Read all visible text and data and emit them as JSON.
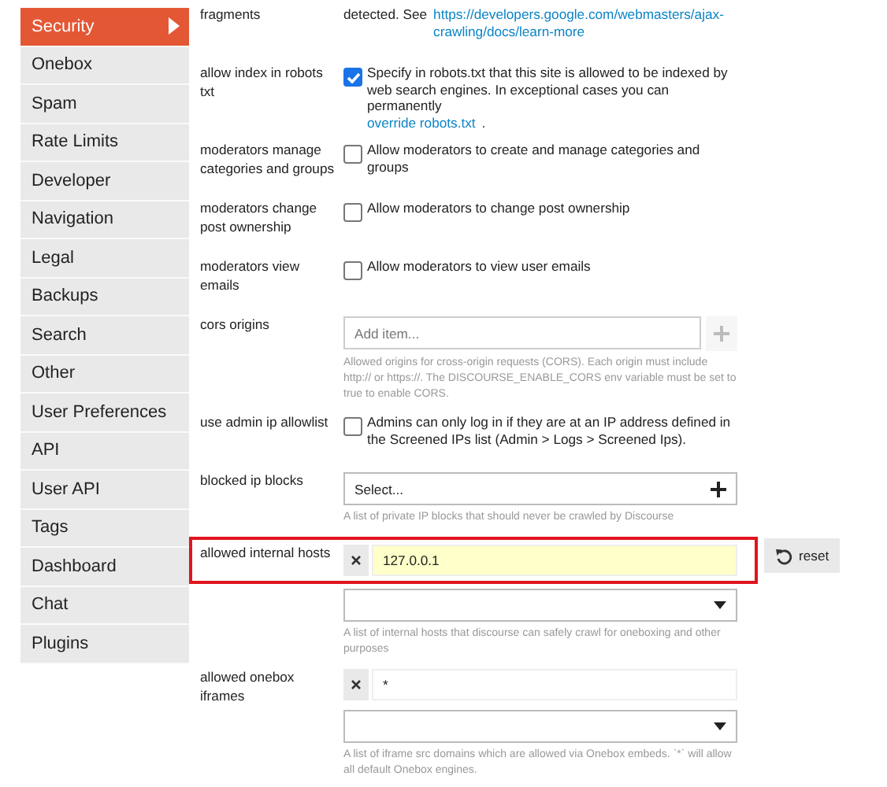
{
  "sidebar": {
    "items": [
      {
        "label": "Security",
        "selected": true
      },
      {
        "label": "Onebox",
        "selected": false
      },
      {
        "label": "Spam",
        "selected": false
      },
      {
        "label": "Rate Limits",
        "selected": false
      },
      {
        "label": "Developer",
        "selected": false
      },
      {
        "label": "Navigation",
        "selected": false
      },
      {
        "label": "Legal",
        "selected": false
      },
      {
        "label": "Backups",
        "selected": false
      },
      {
        "label": "Search",
        "selected": false
      },
      {
        "label": "Other",
        "selected": false
      },
      {
        "label": "User Preferences",
        "selected": false
      },
      {
        "label": "API",
        "selected": false
      },
      {
        "label": "User API",
        "selected": false
      },
      {
        "label": "Tags",
        "selected": false
      },
      {
        "label": "Dashboard",
        "selected": false
      },
      {
        "label": "Chat",
        "selected": false
      },
      {
        "label": "Plugins",
        "selected": false
      }
    ]
  },
  "settings": [
    {
      "kind": "text",
      "label": "fragments",
      "description": [
        {
          "text": "detected. See"
        },
        {
          "link": "https://developers.google.com/webmasters/ajax-crawling/docs/learn-more"
        }
      ]
    },
    {
      "kind": "checkbox",
      "label": "allow index in robots txt",
      "checked": true,
      "description": [
        {
          "text": "Specify in robots.txt that this site is allowed to be indexed by web search engines. In exceptional cases you can permanently"
        },
        {
          "link": "override robots.txt"
        },
        {
          "text": "."
        }
      ]
    },
    {
      "kind": "checkbox",
      "label": "moderators manage categories and groups",
      "checked": false,
      "description": [
        {
          "text": "Allow moderators to create and manage categories and groups"
        }
      ]
    },
    {
      "kind": "checkbox",
      "label": "moderators change post ownership",
      "checked": false,
      "description": [
        {
          "text": "Allow moderators to change post ownership"
        }
      ]
    },
    {
      "kind": "checkbox",
      "label": "moderators view emails",
      "checked": false,
      "description": [
        {
          "text": "Allow moderators to view user emails"
        }
      ]
    },
    {
      "kind": "list",
      "label": "cors origins",
      "placeholder": "Add item...",
      "help": "Allowed origins for cross-origin requests (CORS). Each origin must include http:// or https://. The DISCOURSE_ENABLE_CORS env variable must be set to true to enable CORS."
    },
    {
      "kind": "checkbox",
      "label": "use admin ip allowlist",
      "checked": false,
      "description": [
        {
          "text": "Admins can only log in if they are at an IP address defined in the Screened IPs list (Admin > Logs > Screened Ips)."
        }
      ]
    },
    {
      "kind": "select",
      "label": "blocked ip blocks",
      "value": "Select...",
      "help": "A list of private IP blocks that should never be crawled by Discourse"
    },
    {
      "kind": "chips",
      "label": "allowed internal hosts",
      "highlighted": true,
      "values": [
        "127.0.0.1"
      ],
      "reset": "reset",
      "help": "A list of internal hosts that discourse can safely crawl for oneboxing and other purposes"
    },
    {
      "kind": "chips",
      "label": "allowed onebox iframes",
      "highlighted": false,
      "values": [
        "*"
      ],
      "help": "A list of iframe src domains which are allowed via Onebox embeds. `*` will allow all default Onebox engines."
    }
  ]
}
